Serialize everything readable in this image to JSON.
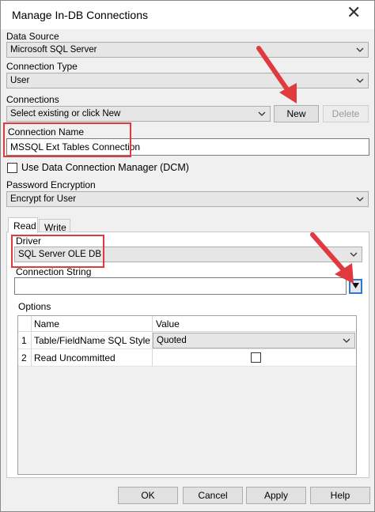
{
  "window": {
    "title": "Manage In-DB Connections",
    "close_glyph": "✕"
  },
  "data_source": {
    "label": "Data Source",
    "value": "Microsoft SQL Server"
  },
  "connection_type": {
    "label": "Connection Type",
    "value": "User"
  },
  "connections": {
    "label": "Connections",
    "value": "Select existing or click New",
    "new_label": "New",
    "delete_label": "Delete"
  },
  "connection_name": {
    "label": "Connection Name",
    "value": "MSSQL Ext Tables Connection"
  },
  "dcm": {
    "label": "Use Data Connection Manager (DCM)",
    "checked": false
  },
  "password_encryption": {
    "label": "Password Encryption",
    "value": "Encrypt for User"
  },
  "tabs": [
    {
      "label": "Read",
      "active": true
    },
    {
      "label": "Write",
      "active": false
    }
  ],
  "driver": {
    "label": "Driver",
    "value": "SQL Server OLE DB"
  },
  "connection_string": {
    "label": "Connection String",
    "value": ""
  },
  "options": {
    "label": "Options",
    "columns": [
      "Name",
      "Value"
    ],
    "rows": [
      {
        "index": "1",
        "name": "Table/FieldName SQL Style",
        "value": "Quoted"
      },
      {
        "index": "2",
        "name": "Read Uncommitted",
        "checked": false
      }
    ]
  },
  "footer": {
    "ok": "OK",
    "cancel": "Cancel",
    "apply": "Apply",
    "help": "Help"
  },
  "colors": {
    "highlight_red": "#e0393e",
    "focus_blue": "#2d7ad6"
  }
}
